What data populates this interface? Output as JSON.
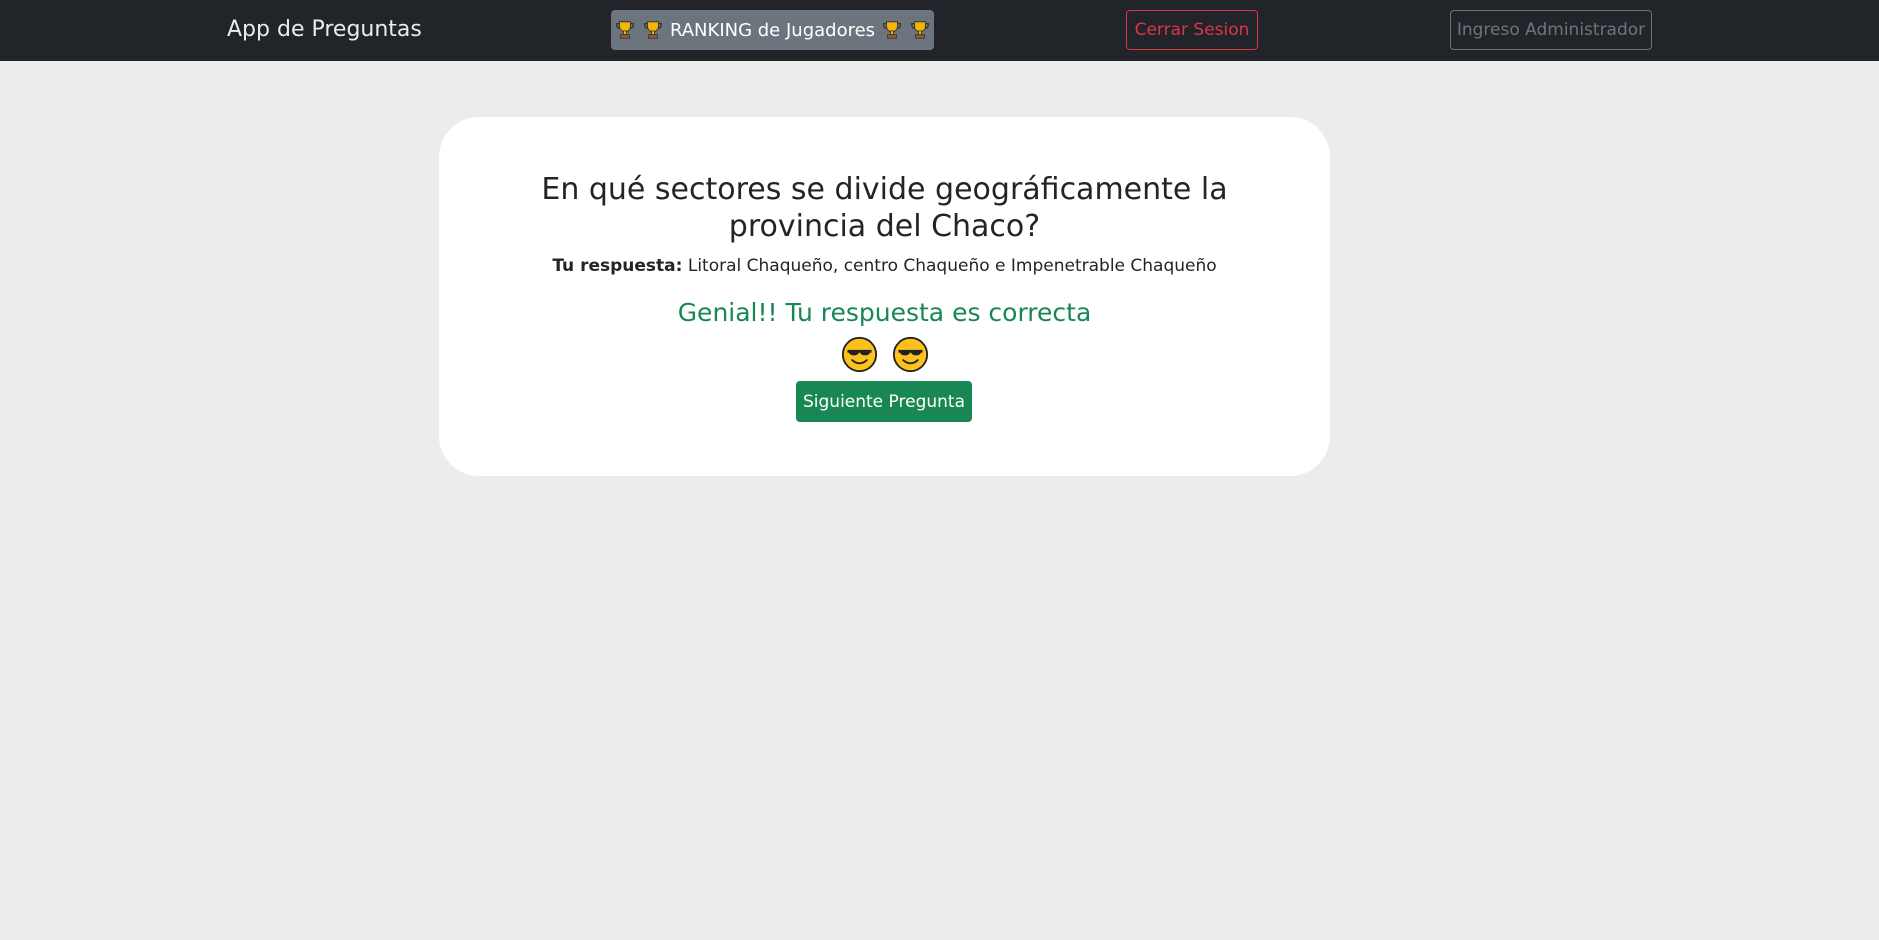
{
  "navbar": {
    "brand": "App de Preguntas",
    "ranking_label": "RANKING de Jugadores",
    "logout_label": "Cerrar Sesion",
    "admin_label": "Ingreso Administrador"
  },
  "card": {
    "question": "En qué sectores se divide geográficamente la provincia del Chaco?",
    "answer_label": "Tu respuesta:",
    "answer_value": "Litoral Chaqueño, centro Chaqueño e Impenetrable Chaqueño",
    "result_message": "Genial!! Tu respuesta es correcta",
    "emojis": [
      "smiling-face-with-sunglasses",
      "smiling-face-with-sunglasses"
    ],
    "next_button": "Siguiente Pregunta"
  },
  "colors": {
    "navbar_bg": "#212529",
    "page_bg": "#ececec",
    "success": "#198754",
    "danger": "#dc3545",
    "secondary": "#6c757d"
  }
}
